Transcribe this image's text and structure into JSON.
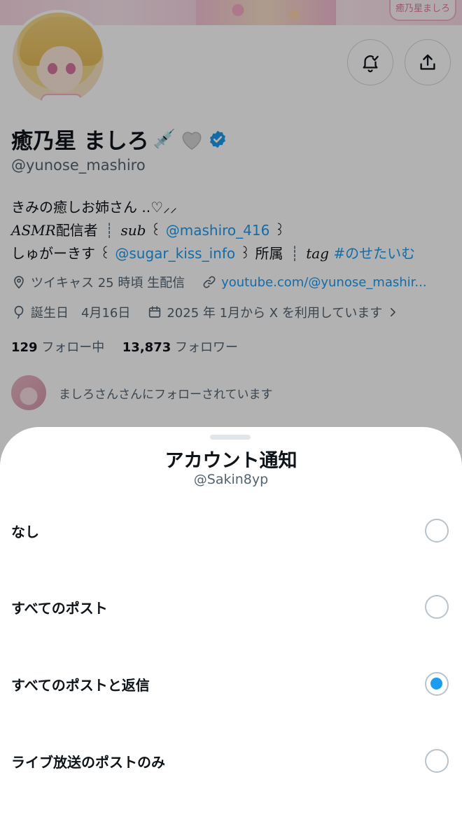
{
  "profile": {
    "banner_logo": "癒乃星ましろ",
    "name": "癒乃星 ましろ",
    "name_emoji": "💉",
    "handle": "@yunose_mashiro",
    "bio": {
      "line1": "きみの癒しお姉さん ..♡⸝⸝",
      "line2_italic1": "ASMR",
      "line2_text1": "配信者",
      "line2_sep": "┊",
      "line2_italic2": "sub",
      "line2_bracket_open": "꒰",
      "line2_link": "@mashiro_416",
      "line2_bracket_close": "꒱",
      "line3_text1": "しゅがーきす",
      "line3_bracket_open": "꒰",
      "line3_link": "@sugar_kiss_info",
      "line3_bracket_close": "꒱",
      "line3_text2": "所属",
      "line3_sep": "┊",
      "line3_italic": "tag",
      "line3_hashtag": "#のせたいむ"
    },
    "location": "ツイキャス 25 時頃 生配信",
    "website": "youtube.com/@yunose_mashir...",
    "birthday": "誕生日　4月16日",
    "joined": "2025 年 1月から X を利用しています",
    "following_count": "129",
    "following_label": "フォロー中",
    "followers_count": "13,873",
    "followers_label": "フォロワー",
    "followed_by": "ましろさんさんにフォローされています"
  },
  "sheet": {
    "title": "アカウント通知",
    "subtitle": "@Sakin8yp",
    "options": [
      {
        "label": "なし",
        "selected": false
      },
      {
        "label": "すべてのポスト",
        "selected": false
      },
      {
        "label": "すべてのポストと返信",
        "selected": true
      },
      {
        "label": "ライブ放送のポストのみ",
        "selected": false
      }
    ]
  },
  "colors": {
    "accent": "#1d9bf0",
    "secondary_text": "#536471"
  }
}
